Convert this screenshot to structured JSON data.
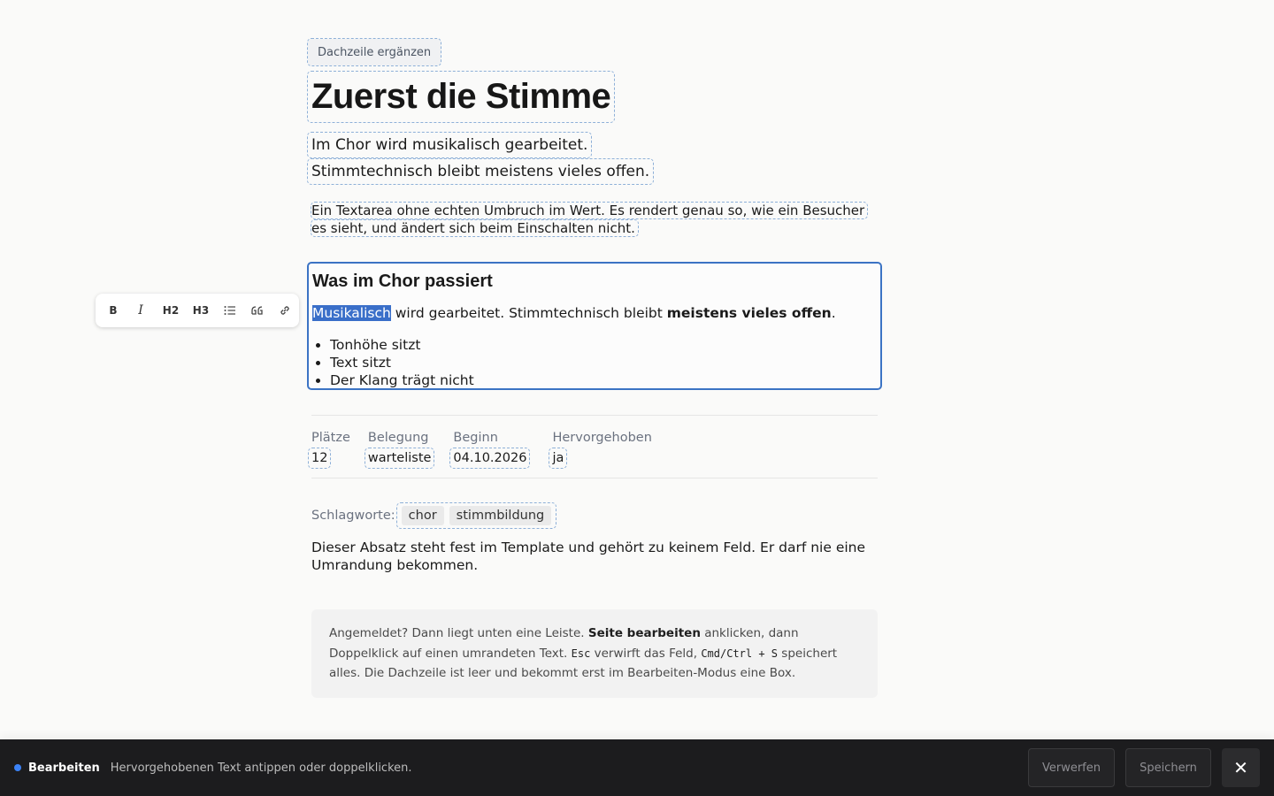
{
  "kicker": "Dachzeile ergänzen",
  "title": "Zuerst die Stimme",
  "subtitle_lines": [
    "Im Chor wird musikalisch gearbeitet.",
    "Stimmtechnisch bleibt meistens vieles offen."
  ],
  "teaser": [
    "Ein Textarea ohne echten Umbruch im Wert. Es rendert genau so, wie ein Besucher",
    "es sieht, und ändert sich beim Einschalten nicht."
  ],
  "rich": {
    "heading": "Was im Chor passiert",
    "p_selected": "Musikalisch",
    "p_mid": " wird gearbeitet. Stimmtechnisch bleibt ",
    "p_bold": "meistens vieles offen",
    "p_end": ".",
    "list": [
      "Tonhöhe sitzt",
      "Text sitzt",
      "Der Klang trägt nicht"
    ]
  },
  "toolbar": {
    "bold": "B",
    "italic": "I",
    "h2": "H2",
    "h3": "H3",
    "list_icon": "bullet-list-icon",
    "quote_icon": "quote-icon",
    "link_icon": "link-icon"
  },
  "facts": [
    {
      "label": "Plätze",
      "value": "12"
    },
    {
      "label": "Belegung",
      "value": "warteliste"
    },
    {
      "label": "Beginn",
      "value": "04.10.2026"
    },
    {
      "label": "Hervorgehoben",
      "value": "ja"
    }
  ],
  "tags": {
    "label": "Schlagworte:",
    "items": [
      "chor",
      "stimmbildung"
    ]
  },
  "static_paragraph": "Dieser Absatz steht fest im Template und gehört zu keinem Feld. Er darf nie eine Umrandung bekommen.",
  "note": {
    "t1": "Angemeldet? Dann liegt unten eine Leiste. ",
    "b1": "Seite bearbeiten",
    "t2": " anklicken, dann Doppelklick auf einen umrandeten Text. ",
    "c1": "Esc",
    "t3": " verwirft das Feld, ",
    "c2": "Cmd/Ctrl + S",
    "t4": " speichert alles. Die Dachzeile ist leer und bekommt erst im Bearbeiten-Modus eine Box."
  },
  "bottom_bar": {
    "mode": "Bearbeiten",
    "hint": "Hervorgehobenen Text antippen oder doppelklicken.",
    "discard": "Verwerfen",
    "save": "Speichern",
    "close": "✕"
  },
  "colors": {
    "accent": "#3b73c4",
    "selection": "#3a6fc9",
    "bar_bg": "#1c1c1e",
    "dot": "#3b82f6"
  }
}
